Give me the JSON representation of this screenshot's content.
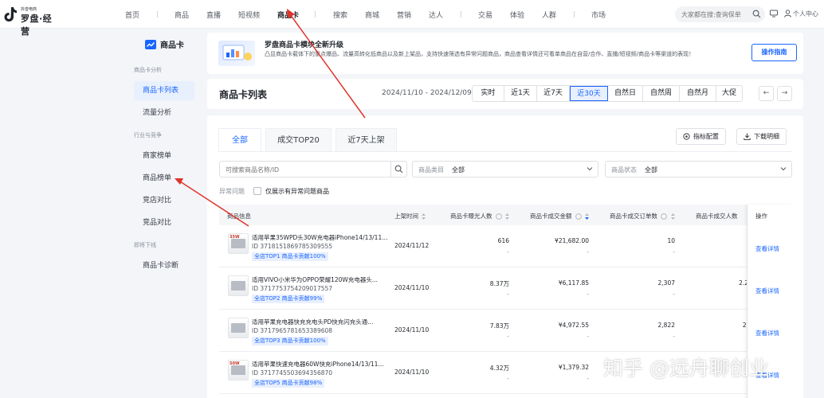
{
  "logo": {
    "small": "抖音电商",
    "big": "罗盘·经营"
  },
  "nav": {
    "items": [
      "首页",
      "商品",
      "直播",
      "短视频",
      "商品卡",
      "搜索",
      "商城",
      "营销",
      "达人",
      "交易",
      "体验",
      "人群",
      "市场"
    ],
    "active": "商品卡",
    "search_placeholder": "大家都在搜:查询保单",
    "user_label": "个人中心"
  },
  "sidebar": {
    "header": "商品卡",
    "group1": "商品卡分析",
    "items1": [
      "商品卡列表",
      "流量分析"
    ],
    "group2": "行业与竞争",
    "items2": [
      "商家榜单",
      "商品榜单",
      "竞店对比",
      "竞品对比"
    ],
    "group3": "即将下线",
    "items3": [
      "商品卡诊断"
    ]
  },
  "banner": {
    "title": "罗盘商品卡模块全新升级",
    "desc": "凸显商品卡载体下的重点爆品、流量高转化低商品以及新上架品，支持快速筛选有异常问题商品，商品查看详情还可看单商品在自营/合作、直播/短视频/商品卡等渠道的表现！",
    "button": "操作指南"
  },
  "datepanel": {
    "title": "商品卡列表",
    "range": "2024/11/10 - 2024/12/09",
    "options": [
      "实时",
      "近1天",
      "近7天",
      "近30天",
      "自然日",
      "自然周",
      "自然月",
      "大促"
    ],
    "active": "近30天",
    "prev": "←",
    "next": "→"
  },
  "tabs": [
    "全部",
    "成交TOP20",
    "近7天上架"
  ],
  "active_tab": "全部",
  "tools": {
    "metrics": "指标配置",
    "download": "下载明细"
  },
  "filters": {
    "search_placeholder": "可搜索商品名称/ID",
    "category_label": "商品类目",
    "category_value": "全部",
    "status_label": "商品状态",
    "status_value": "全部"
  },
  "anomaly": {
    "label": "异常问题",
    "checkbox": "仅展示有异常问题商品"
  },
  "table": {
    "headers": [
      "商品信息",
      "上架时间",
      "商品卡曝光人数",
      "商品卡成交金额",
      "商品卡成交订单数",
      "商品卡成交人数",
      "操作"
    ],
    "rows": [
      {
        "name": "适用苹果35WPD头30W充电器iPhone14/13/11...",
        "id": "ID  3718151869785309555",
        "badge": "全店TOP1  商品卡贡献100%",
        "thumb": "35W",
        "date": "2024/11/12",
        "exposure": "616",
        "amount": "¥21,682.00",
        "orders": "10",
        "buyers": "",
        "sub": "-",
        "action": "查看详情"
      },
      {
        "name": "适用VIVO小米华为OPPO荣耀120W充电器头...",
        "id": "ID  3717753754209017557",
        "badge": "全店TOP2  商品卡贡献99%",
        "thumb": "",
        "date": "2024/11/10",
        "exposure": "8.37万",
        "amount": "¥6,117.85",
        "orders": "2,307",
        "buyers": "2.2",
        "sub": "-",
        "action": "查看详情"
      },
      {
        "name": "适用苹果充电器快充充电头PD快充闪充头通...",
        "id": "ID  3717965781653389608",
        "badge": "全店TOP3  商品卡贡献100%",
        "thumb": "",
        "date": "2024/11/10",
        "exposure": "7.83万",
        "amount": "¥4,972.55",
        "orders": "2,822",
        "buyers": "2.",
        "sub": "-",
        "action": "查看详情"
      },
      {
        "name": "适用苹果快速充电器60W快充iPhone14/13/11...",
        "id": "ID  3717745503694356870",
        "badge": "全店TOP5  商品卡贡献98%",
        "thumb": "50W",
        "date": "2024/11/10",
        "exposure": "4.32万",
        "amount": "¥1,379.32",
        "orders": "",
        "buyers": "",
        "sub": "-",
        "action": "查看详情"
      }
    ]
  },
  "watermark": "知乎 @远舟聊创业",
  "colors": {
    "accent": "#1966ff",
    "arrow": "#e0332a",
    "active_bg": "#e8effd"
  }
}
